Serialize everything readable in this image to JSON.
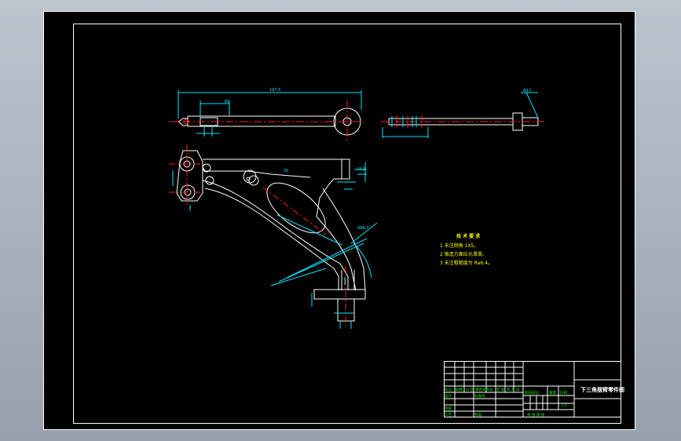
{
  "drawing": {
    "dimensions": {
      "overall_length": "197.5",
      "top_small_left": "30",
      "top_right_label": "Φ17",
      "front_right_top": "43.5",
      "front_arc_radius": "R88.7",
      "front_small_num": "50"
    },
    "technical_requirements": {
      "title": "技 术 要 求",
      "items": [
        "1 未注倒角 1X5。",
        "2 锻造方面应光滑滑。",
        "3 未注粗糙度为 Ra6.4。"
      ]
    },
    "title_block": {
      "part_name": "下三角摆臂零件图",
      "labels": {
        "mark": "标记",
        "count": "处数",
        "zone": "分 区",
        "doc_no": "更改文件号",
        "sign": "签 名",
        "date": "年 月 日",
        "design": "设计",
        "std": "标准化",
        "audit": "审核",
        "process": "工艺",
        "approve": "批准",
        "stage_mark": "阶段标记",
        "weight": "重量",
        "scale": "比例",
        "scale_value": "1:1",
        "sheets": "共 张  第 张"
      }
    }
  },
  "colors": {
    "sheet": "#000000",
    "frame": "#ffffff",
    "cyan": "#00e5ff",
    "red": "#ff2020",
    "yellow": "#ffff00",
    "green": "#00ff00"
  }
}
